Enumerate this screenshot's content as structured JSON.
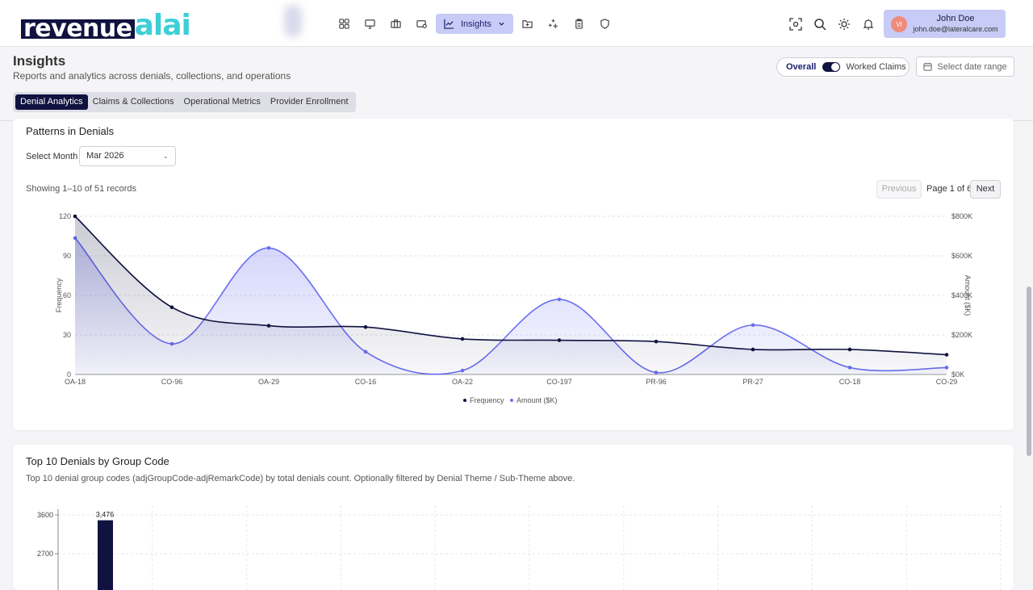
{
  "app": {
    "logo_part1": "revenue",
    "logo_part2": "alai"
  },
  "nav": {
    "active_label": "Insights"
  },
  "user": {
    "initials": "VI",
    "name": "John Doe",
    "email": "john.doe@lateralcare.com"
  },
  "header": {
    "title": "Insights",
    "subtitle": "Reports and analytics across denials, collections, and operations",
    "toggle_left": "Overall",
    "toggle_right": "Worked Claims",
    "date_placeholder": "Select date range"
  },
  "tabs": [
    {
      "label": "Denial Analytics",
      "active": true
    },
    {
      "label": "Claims & Collections",
      "active": false
    },
    {
      "label": "Operational Metrics",
      "active": false
    },
    {
      "label": "Provider Enrollment",
      "active": false
    }
  ],
  "patterns": {
    "title": "Patterns in Denials",
    "select_label": "Select Month",
    "select_value": "Mar 2026",
    "showing": "Showing 1–10 of 51 records",
    "prev_label": "Previous",
    "page_info": "Page 1 of 6",
    "next_label": "Next"
  },
  "top10": {
    "title": "Top 10 Denials by Group Code",
    "description": "Top 10 denial group codes (adjGroupCode-adjRemarkCode) by total denials count. Optionally filtered by Denial Theme / Sub-Theme above."
  },
  "colors": {
    "navy": "#10123f",
    "accent": "#6a6ff0",
    "light": "#c7cbf5"
  },
  "chart_data": [
    {
      "type": "line",
      "categories": [
        "OA-18",
        "CO-96",
        "OA-29",
        "CO-16",
        "OA-22",
        "CO-197",
        "PR-96",
        "PR-27",
        "CO-18",
        "CO-29"
      ],
      "series": [
        {
          "name": "Frequency",
          "axis": "left",
          "color": "#10123f",
          "values": [
            120,
            51,
            37,
            36,
            27,
            26,
            25,
            19,
            19,
            15
          ]
        },
        {
          "name": "Amount ($K)",
          "axis": "right",
          "color": "#6a6ff0",
          "values": [
            690,
            155,
            640,
            115,
            20,
            380,
            10,
            250,
            35,
            35
          ]
        }
      ],
      "ylabel": "Frequency",
      "y2label": "Amount ($K)",
      "ylim": [
        0,
        120
      ],
      "y2lim": [
        0,
        800
      ],
      "yticks": [
        "0",
        "30",
        "60",
        "90",
        "120"
      ],
      "y2ticks": [
        "$0K",
        "$200K",
        "$400K",
        "$600K",
        "$800K"
      ],
      "legend": "bottom",
      "grid": true
    },
    {
      "type": "bar",
      "categories": [
        ""
      ],
      "values": [
        3476
      ],
      "data_labels": [
        "3,476"
      ],
      "yticks": [
        "2700",
        "3600"
      ],
      "grid": true
    }
  ]
}
